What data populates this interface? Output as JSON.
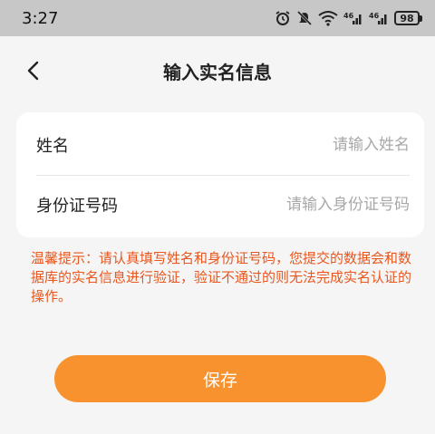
{
  "status_bar": {
    "time": "3:27",
    "signal1_label": "⁴⁶",
    "signal2_label": "⁴⁶",
    "battery": "98"
  },
  "header": {
    "back_icon": "chevron-left-icon",
    "title": "输入实名信息"
  },
  "form": {
    "name_label": "姓名",
    "name_placeholder": "请输入姓名",
    "name_value": "",
    "id_label": "身份证号码",
    "id_placeholder": "请输入身份证号码",
    "id_value": ""
  },
  "tip": "温馨提示：请认真填写姓名和身份证号码，您提交的数据会和数据库的实名信息进行验证，验证不通过的则无法完成实名认证的操作。",
  "actions": {
    "save_label": "保存"
  },
  "colors": {
    "accent": "#f7922f",
    "warning_text": "#e8571e",
    "background": "#f5f5f5",
    "status_bar": "#c7c7c7"
  }
}
